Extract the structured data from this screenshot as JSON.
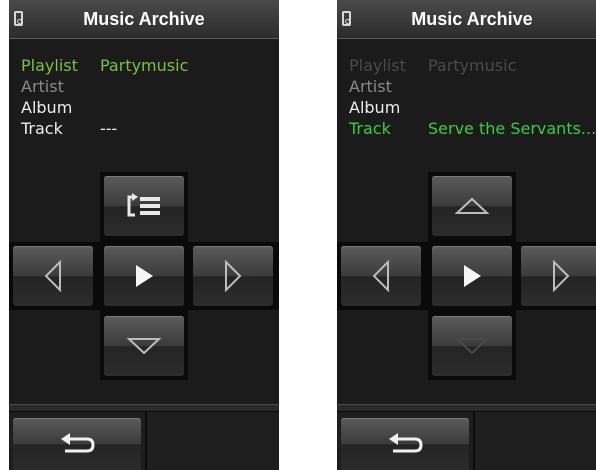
{
  "screens": [
    {
      "title": "Music Archive",
      "rows": [
        {
          "label": "Playlist",
          "value": "Partymusic"
        },
        {
          "label": "Artist",
          "value": ""
        },
        {
          "label": "Album",
          "value": ""
        },
        {
          "label": "Track",
          "value": "---"
        }
      ],
      "icons": {
        "top": "playlist-mode-icon",
        "left": "prev-arrow-icon",
        "center": "play-icon",
        "right": "next-arrow-icon",
        "bottom": "down-arrow-icon",
        "back": "back-arrow-icon"
      }
    },
    {
      "title": "Music Archive",
      "rows": [
        {
          "label": "Playlist",
          "value": "Partymusic"
        },
        {
          "label": "Artist",
          "value": ""
        },
        {
          "label": "Album",
          "value": ""
        },
        {
          "label": "Track",
          "value": "Serve the Servants..."
        }
      ],
      "icons": {
        "top": "up-arrow-icon",
        "left": "prev-arrow-icon",
        "center": "play-icon",
        "right": "next-arrow-icon",
        "bottom": "down-arrow-icon",
        "back": "back-arrow-icon"
      }
    }
  ],
  "colors": {
    "highlight_green": "#7ac142",
    "selected_green": "#36cf3a",
    "background": "#1b1b1b"
  }
}
